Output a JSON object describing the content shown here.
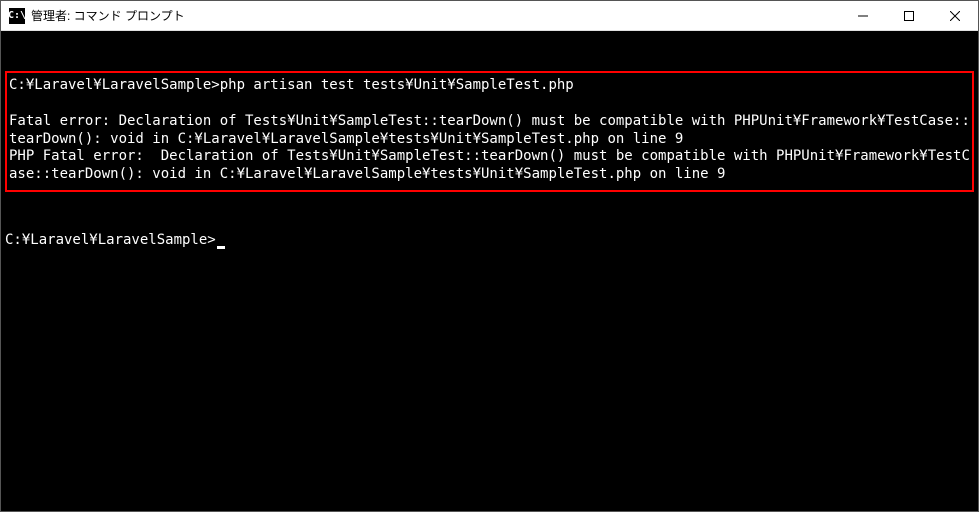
{
  "window": {
    "title": "管理者: コマンド プロンプト",
    "icon_label": "C:\\"
  },
  "terminal": {
    "highlighted": {
      "line1": "C:¥Laravel¥LaravelSample>php artisan test tests¥Unit¥SampleTest.php",
      "line2": "Fatal error: Declaration of Tests¥Unit¥SampleTest::tearDown() must be compatible with PHPUnit¥Framework¥TestCase::tearDown(): void in C:¥Laravel¥LaravelSample¥tests¥Unit¥SampleTest.php on line 9",
      "line3": "PHP Fatal error:  Declaration of Tests¥Unit¥SampleTest::tearDown() must be compatible with PHPUnit¥Framework¥TestCase::tearDown(): void in C:¥Laravel¥LaravelSample¥tests¥Unit¥SampleTest.php on line 9"
    },
    "prompt": "C:¥Laravel¥LaravelSample>"
  }
}
